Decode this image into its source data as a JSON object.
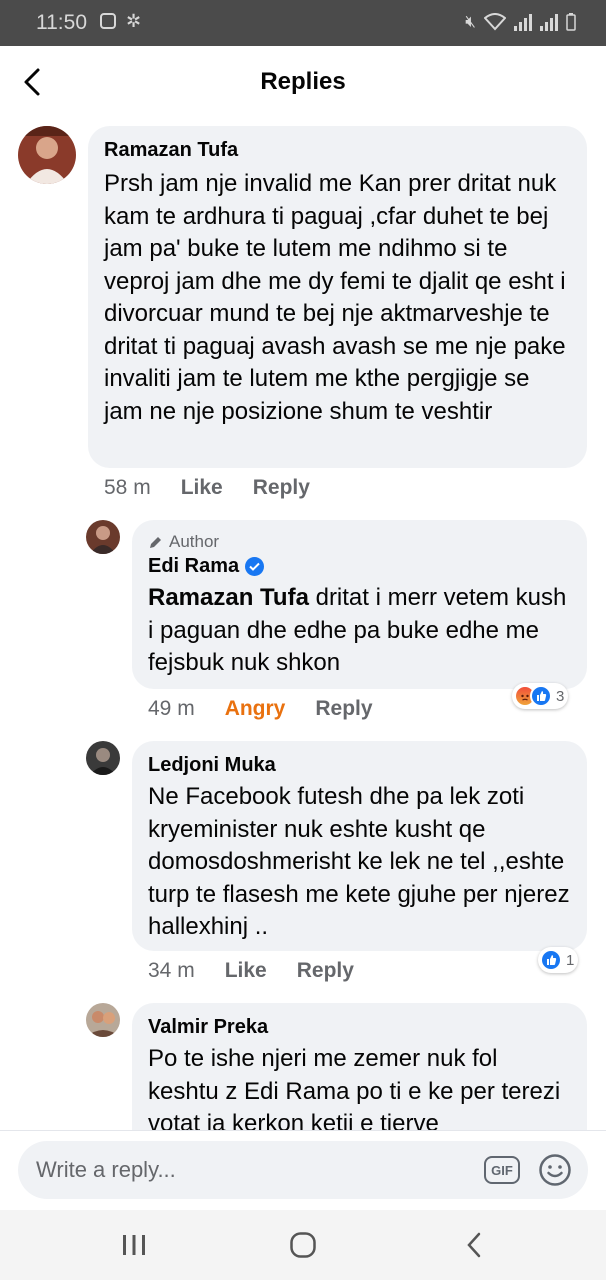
{
  "status_bar": {
    "time": "11:50"
  },
  "header": {
    "title": "Replies"
  },
  "comments": [
    {
      "name": "Ramazan Tufa",
      "text": "Prsh jam nje invalid me Kan  prer dritat nuk kam  te ardhura ti paguaj ,cfar duhet te bej jam pa' buke te lutem me ndihmo si te veproj jam dhe me dy femi te djalit qe esht i divorcuar mund te bej nje aktmarveshje te dritat ti paguaj avash avash se me nje pake invaliti jam te lutem me kthe pergjigje se jam ne nje posizione shum te veshtir",
      "time": "58 m",
      "like_label": "Like",
      "reply_label": "Reply"
    },
    {
      "author_badge": "Author",
      "name": "Edi Rama",
      "mention": "Ramazan Tufa",
      "text": " dritat i merr vetem kush i paguan dhe edhe pa buke edhe me fejsbuk nuk shkon",
      "time": "49 m",
      "like_label": "Angry",
      "reply_label": "Reply",
      "reaction_count": "3"
    },
    {
      "name": "Ledjoni Muka",
      "text": "Ne Facebook futesh dhe pa lek zoti kryeminister nuk eshte kusht qe domosdoshmerisht ke lek ne tel ,,eshte turp te flasesh me kete gjuhe per njerez hallexhinj ..",
      "time": "34 m",
      "like_label": "Like",
      "reply_label": "Reply",
      "reaction_count": "1"
    },
    {
      "name": "Valmir Preka",
      "text": "Po te ishe njeri me zemer nuk fol keshtu z Edi Rama po ti e ke per terezi votat ia kerkon ketij e tjerve"
    }
  ],
  "composer": {
    "placeholder": "Write a reply...",
    "gif_label": "GIF"
  },
  "colors": {
    "bubble": "#f0f2f5",
    "meta": "#65676b",
    "angry": "#e9710f",
    "like_blue": "#1877f2"
  },
  "icons": [
    "back-arrow-icon",
    "verified-badge-icon",
    "pencil-icon",
    "angry-reaction-icon",
    "like-reaction-icon",
    "gif-icon",
    "sticker-icon",
    "recents-icon",
    "home-icon",
    "nav-back-icon"
  ]
}
